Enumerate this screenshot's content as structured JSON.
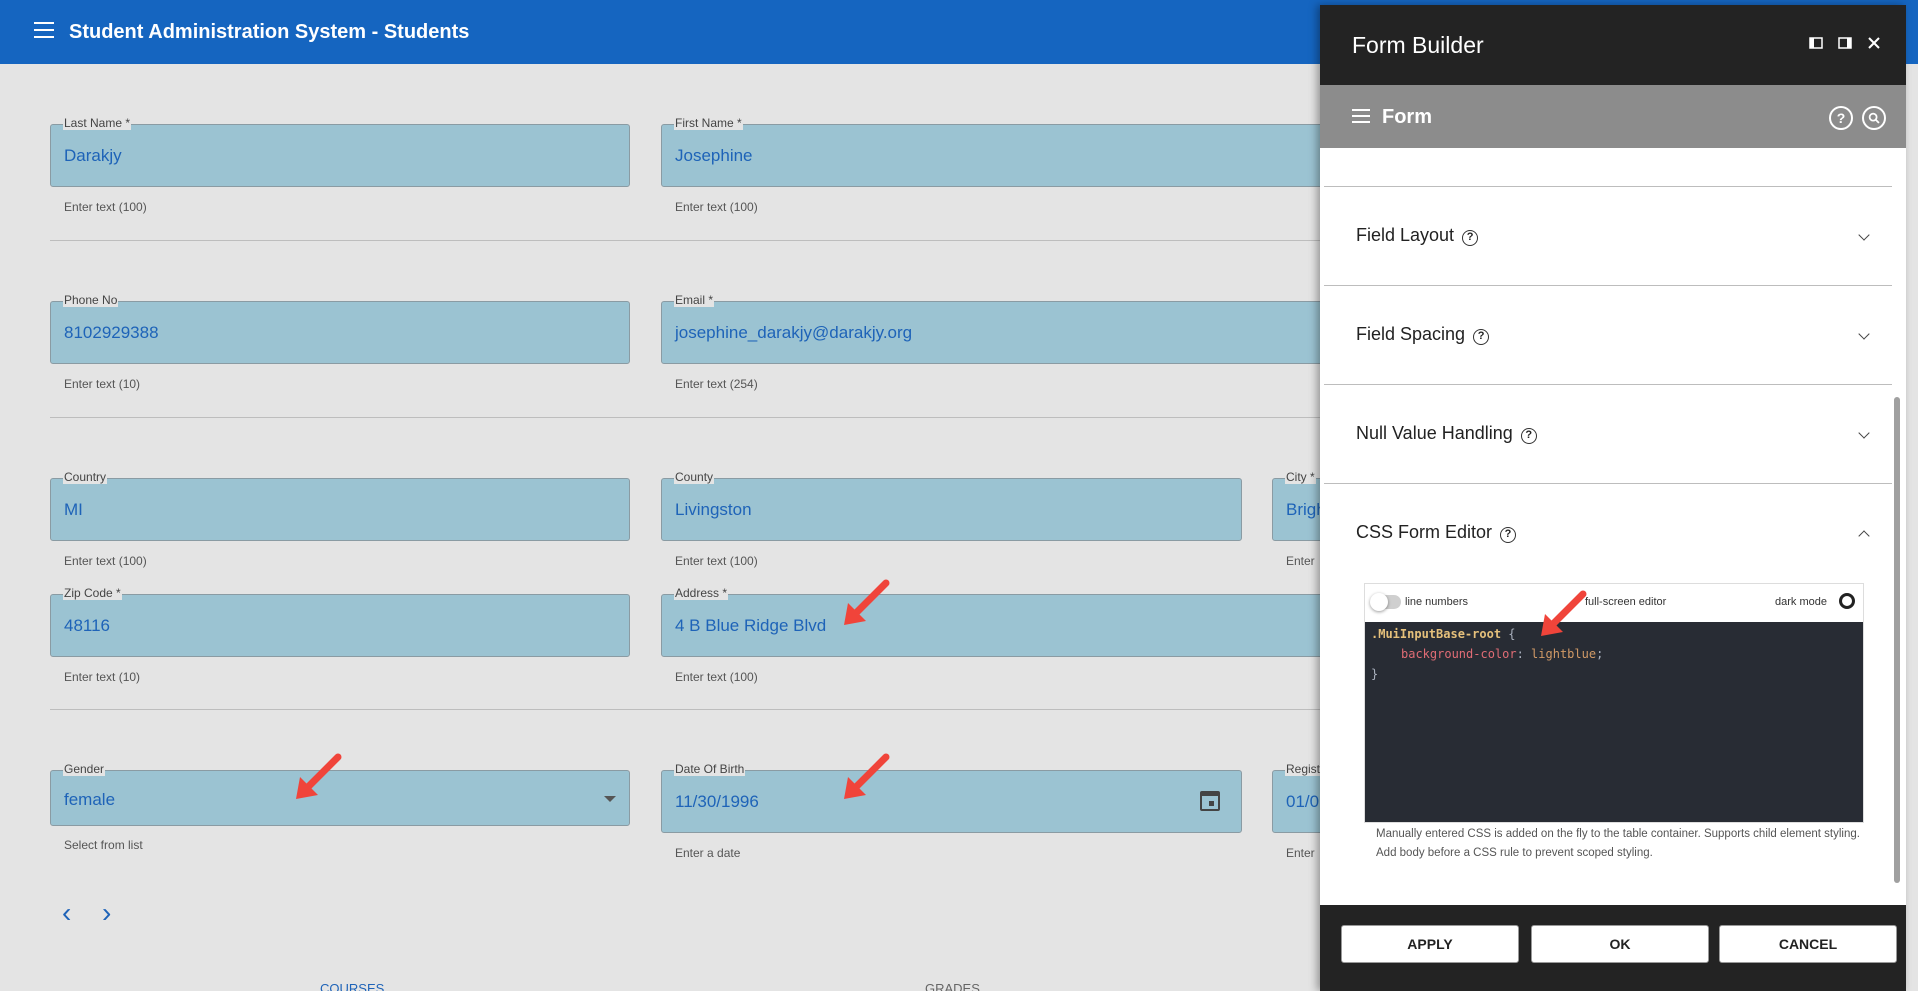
{
  "app": {
    "title": "Student Administration System - Students"
  },
  "form": {
    "last_name": {
      "label": "Last Name *",
      "value": "Darakjy",
      "help": "Enter text (100)"
    },
    "first_name": {
      "label": "First Name *",
      "value": "Josephine",
      "help": "Enter text (100)"
    },
    "phone": {
      "label": "Phone No",
      "value": "8102929388",
      "help": "Enter text (10)"
    },
    "email": {
      "label": "Email *",
      "value": "josephine_darakjy@darakjy.org",
      "help": "Enter text (254)"
    },
    "country": {
      "label": "Country",
      "value": "MI",
      "help": "Enter text (100)"
    },
    "county": {
      "label": "County",
      "value": "Livingston",
      "help": "Enter text (100)"
    },
    "city": {
      "label": "City *",
      "value": "Brigh",
      "help": "Enter"
    },
    "zip": {
      "label": "Zip Code *",
      "value": "48116",
      "help": "Enter text (10)"
    },
    "address": {
      "label": "Address *",
      "value": "4 B Blue Ridge Blvd",
      "help": "Enter text (100)"
    },
    "gender": {
      "label": "Gender",
      "value": "female",
      "help": "Select from list"
    },
    "dob": {
      "label": "Date Of Birth",
      "value": "11/30/1996",
      "help": "Enter a date"
    },
    "registration": {
      "label": "Regist",
      "value": "01/0",
      "help": "Enter"
    },
    "tabs": [
      "COURSES",
      "GRADES"
    ]
  },
  "panel": {
    "title": "Form Builder",
    "subtitle": "Form",
    "help_glyph": "?",
    "sections": [
      "Field Layout",
      "Field Spacing",
      "Null Value Handling",
      "CSS Form Editor"
    ],
    "editor": {
      "line_numbers": "line numbers",
      "full_screen": "full-screen editor",
      "dark_mode": "dark mode",
      "code": {
        "selector": ".MuiInputBase-root",
        "open": " {",
        "property": "background-color",
        "colon": ": ",
        "value": "lightblue",
        "semi": ";",
        "close": "}"
      },
      "note": "Manually entered CSS is added on the fly to the table container. Supports child element styling. Add body before a CSS rule to prevent scoped styling."
    },
    "buttons": {
      "apply": "APPLY",
      "ok": "OK",
      "cancel": "CANCEL"
    }
  },
  "colors": {
    "appbar": "#1565c0",
    "field_bg": "#9bc3d2",
    "field_text": "#1e63b8",
    "annotation_arrow": "#f0443a"
  }
}
